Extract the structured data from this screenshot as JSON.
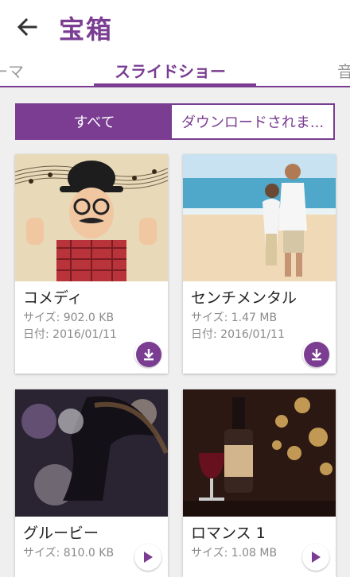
{
  "header": {
    "title": "宝箱"
  },
  "tabs": [
    {
      "label": "ーマ"
    },
    {
      "label": "スライドショー"
    },
    {
      "label": "音"
    }
  ],
  "filter": {
    "all": "すべて",
    "downloaded": "ダウンロードされま..."
  },
  "size_prefix": "サイズ: ",
  "date_prefix": "日付: ",
  "cards": [
    {
      "name": "コメディ",
      "size": "サイズ: 902.0 KB",
      "date": "日付: 2016/01/11"
    },
    {
      "name": "センチメンタル",
      "size": "サイズ: 1.47 MB",
      "date": "日付: 2016/01/11"
    },
    {
      "name": "グルービー",
      "size": "サイズ: 810.0 KB",
      "date": ""
    },
    {
      "name": "ロマンス 1",
      "size": "サイズ: 1.08 MB",
      "date": ""
    }
  ],
  "colors": {
    "accent": "#7a3d92",
    "background": "#efefef"
  }
}
